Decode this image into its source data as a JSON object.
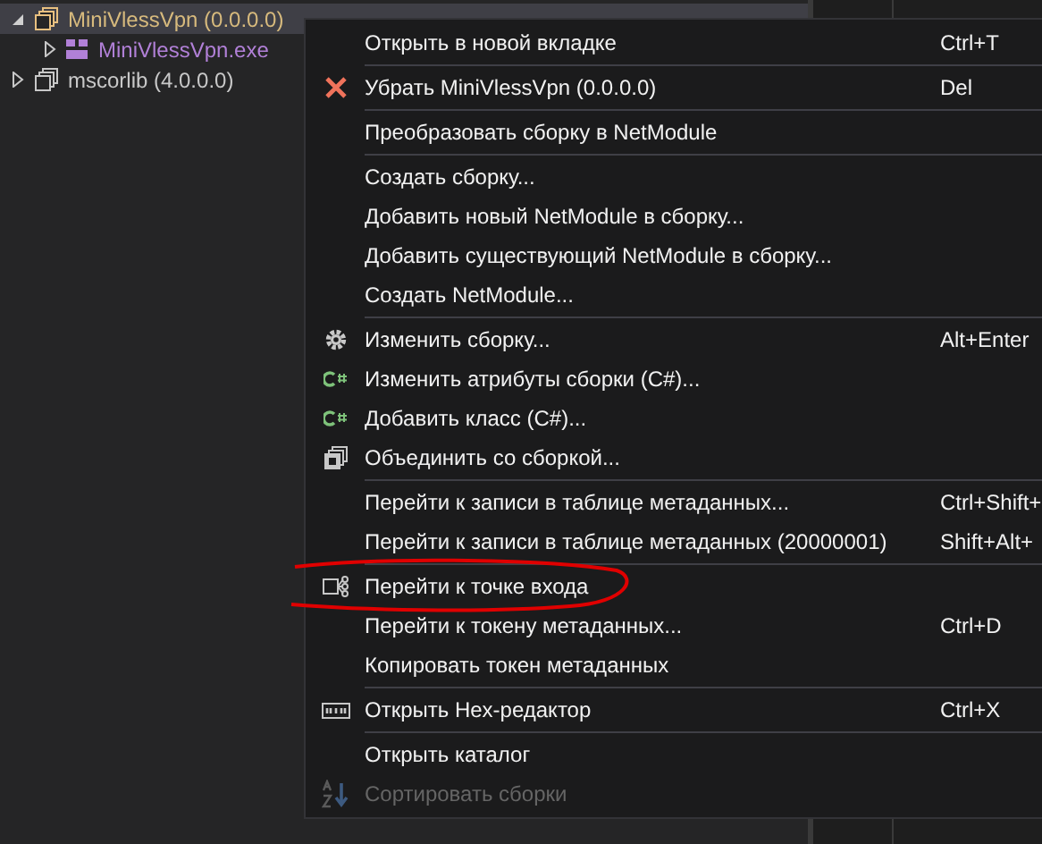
{
  "tree": [
    {
      "label": "MiniVlessVpn (0.0.0.0)",
      "kind": "assembly",
      "expanded": true,
      "selected": true,
      "children": [
        {
          "label": "MiniVlessVpn.exe",
          "kind": "module",
          "expanded": false,
          "selected": false
        }
      ]
    },
    {
      "label": "mscorlib (4.0.0.0)",
      "kind": "assembly",
      "expanded": false,
      "selected": false
    }
  ],
  "context_menu": {
    "groups": [
      [
        {
          "label": "Открыть в новой вкладке",
          "shortcut": "Ctrl+T",
          "disabled": false,
          "circled": false
        }
      ],
      [
        {
          "label": "Убрать MiniVlessVpn (0.0.0.0)",
          "shortcut": "Del",
          "disabled": false,
          "circled": false
        }
      ],
      [
        {
          "label": "Преобразовать сборку в NetModule",
          "disabled": false,
          "circled": false
        }
      ],
      [
        {
          "label": "Создать сборку...",
          "disabled": false,
          "circled": false
        },
        {
          "label": "Добавить новый NetModule в сборку...",
          "disabled": false,
          "circled": false
        },
        {
          "label": "Добавить существующий NetModule в сборку...",
          "disabled": false,
          "circled": false
        },
        {
          "label": "Создать NetModule...",
          "disabled": false,
          "circled": false
        }
      ],
      [
        {
          "label": "Изменить сборку...",
          "shortcut": "Alt+Enter",
          "disabled": false,
          "circled": false
        },
        {
          "label": "Изменить атрибуты сборки (C#)...",
          "disabled": false,
          "circled": false
        },
        {
          "label": "Добавить класс (C#)...",
          "disabled": false,
          "circled": false
        },
        {
          "label": "Объединить со сборкой...",
          "disabled": false,
          "circled": false
        }
      ],
      [
        {
          "label": "Перейти к записи в таблице метаданных...",
          "shortcut": "Ctrl+Shift+",
          "disabled": false,
          "circled": false
        },
        {
          "label": "Перейти к записи в таблице метаданных (20000001)",
          "shortcut": "Shift+Alt+",
          "disabled": false,
          "circled": false
        }
      ],
      [
        {
          "label": "Перейти к точке входа",
          "disabled": false,
          "circled": true
        },
        {
          "label": "Перейти к токену метаданных...",
          "shortcut": "Ctrl+D",
          "disabled": false,
          "circled": false
        },
        {
          "label": "Копировать токен метаданных",
          "disabled": false,
          "circled": false
        }
      ],
      [
        {
          "label": "Открыть Hex-редактор",
          "shortcut": "Ctrl+X",
          "disabled": false,
          "circled": false
        }
      ],
      [
        {
          "label": "Открыть каталог",
          "disabled": false,
          "circled": false
        },
        {
          "label": "Сортировать сборки",
          "disabled": true,
          "circled": false
        }
      ]
    ]
  }
}
